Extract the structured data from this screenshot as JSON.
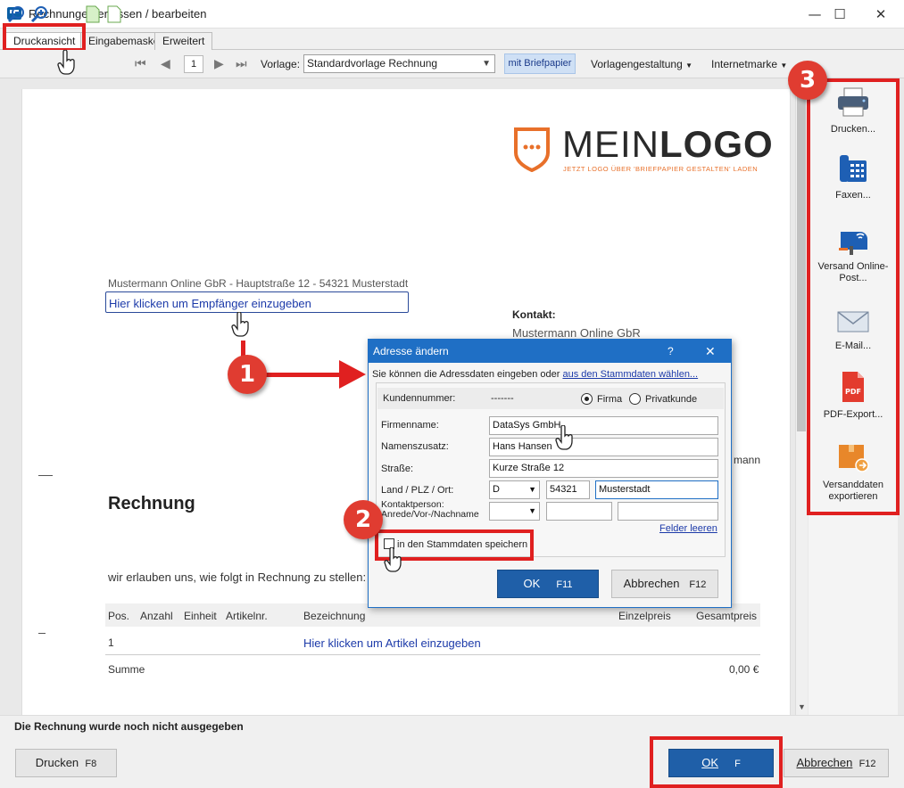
{
  "window": {
    "title": "Rechnungen erfassen / bearbeiten",
    "minimize": "—",
    "maximize": "☐",
    "close": "✕"
  },
  "tabs": [
    {
      "label": "Druckansicht",
      "active": true
    },
    {
      "label": "Eingabemaske",
      "active": false
    },
    {
      "label": "Erweitert",
      "active": false
    }
  ],
  "toolbar": {
    "page_number": "1",
    "vorlage_label": "Vorlage:",
    "vorlage_value": "Standardvorlage Rechnung",
    "briefpapier_button": "mit Briefpapier",
    "vorlagengestaltung": "Vorlagengestaltung",
    "internetmarke": "Internetmarke"
  },
  "logo": {
    "main_light": "MEIN",
    "main_bold": "LOGO",
    "tagline": "JETZT LOGO ÜBER 'BRIEFPAPIER GESTALTEN' LADEN",
    "accent_color": "#e8702a"
  },
  "document": {
    "sender_line": "Mustermann Online GbR - Hauptstraße 12 - 54321 Musterstadt",
    "recipient_placeholder": "Hier klicken um Empfänger einzugeben",
    "contact_heading": "Kontakt:",
    "contact_name": "Mustermann Online GbR",
    "contact_partial": "mann",
    "invoice_title": "Rechnung",
    "intro_text": "wir erlauben uns, wie folgt in Rechnung zu stellen:",
    "columns": [
      "Pos.",
      "Anzahl",
      "Einheit",
      "Artikelnr.",
      "Bezeichnung",
      "Einzelpreis",
      "Gesamtpreis"
    ],
    "row_pos": "1",
    "article_placeholder": "Hier klicken um Artikel einzugeben",
    "sum_label": "Summe",
    "sum_value": "0,00 €"
  },
  "sidepanel": {
    "items": [
      {
        "label": "Drucken...",
        "icon": "printer-icon"
      },
      {
        "label": "Faxen...",
        "icon": "fax-icon"
      },
      {
        "label": "Versand Online-Post...",
        "icon": "mailbox-icon"
      },
      {
        "label": "E-Mail...",
        "icon": "email-icon"
      },
      {
        "label": "PDF-Export...",
        "icon": "pdf-icon"
      },
      {
        "label": "Versanddaten exportieren",
        "icon": "package-export-icon"
      }
    ]
  },
  "dialog": {
    "title": "Adresse ändern",
    "help": "?",
    "close": "✕",
    "intro": "Sie können die Adressdaten eingeben oder",
    "stamm_link": "aus den Stammdaten wählen...",
    "kundennummer_label": "Kundennummer:",
    "kundennummer_value": "-------",
    "radio_firma": "Firma",
    "radio_privat": "Privatkunde",
    "firmenname_label": "Firmenname:",
    "firmenname_value": "DataSys GmbH",
    "namenszusatz_label": "Namenszusatz:",
    "namenszusatz_value": "Hans Hansen",
    "strasse_label": "Straße:",
    "strasse_value": "Kurze Straße 12",
    "land_label": "Land / PLZ / Ort:",
    "land_value": "D",
    "plz_value": "54321",
    "ort_value": "Musterstadt",
    "kontakt_label1": "Kontaktperson:",
    "kontakt_label2": "Anrede/Vor-/Nachname",
    "felder_leeren": "Felder leeren",
    "save_checkbox": "in den Stammdaten speichern",
    "ok_label": "OK",
    "ok_key": "F11",
    "cancel_label": "Abbrechen",
    "cancel_key": "F12"
  },
  "status": {
    "message": "Die Rechnung wurde noch nicht ausgegeben"
  },
  "bottom": {
    "print_label": "Drucken",
    "print_key": "F8",
    "ok_label": "OK",
    "ok_key": "F",
    "cancel_label": "Abbrechen",
    "cancel_key": "F12"
  },
  "annotations": {
    "badge1": "1",
    "badge2": "2",
    "badge3": "3",
    "highlight_color": "#e02020"
  }
}
